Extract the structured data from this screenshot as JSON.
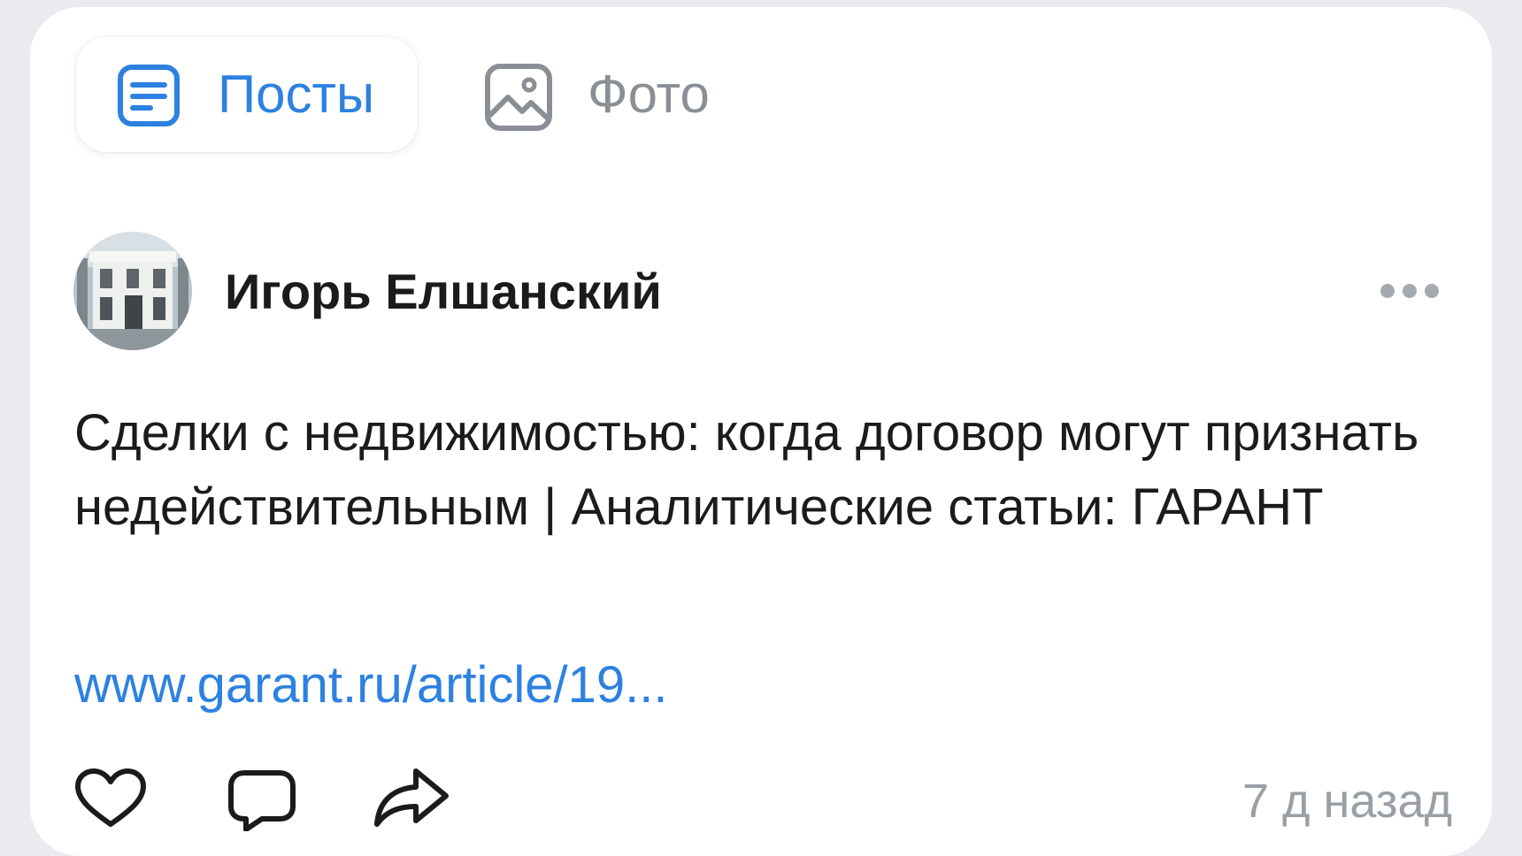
{
  "tabs": {
    "posts": {
      "label": "Посты",
      "icon": "document-lines-icon",
      "active": true
    },
    "photos": {
      "label": "Фото",
      "icon": "image-icon",
      "active": false
    }
  },
  "post": {
    "author": "Игорь Елшанский",
    "avatar": "building-photo-avatar",
    "text": "Сделки с недвижимостью: когда договор могут признать недействительным | Аналитические статьи: ГАРАНТ",
    "link": "www.garant.ru/article/19...",
    "timestamp": "7 д назад",
    "actions": [
      "heart-icon",
      "comment-icon",
      "share-icon"
    ],
    "menu_icon": "more-dots-icon"
  },
  "colors": {
    "accent": "#2d81e0",
    "text": "#1b1b1d",
    "muted": "#8a8f96",
    "background": "#e9ebee",
    "card": "#ffffff"
  }
}
